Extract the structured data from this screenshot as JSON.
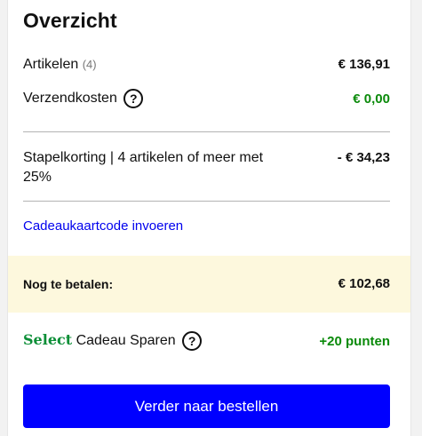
{
  "summary": {
    "title": "Overzicht",
    "articles_label": "Artikelen",
    "articles_count": "(4)",
    "articles_amount": "€ 136,91",
    "shipping_label": "Verzendkosten",
    "shipping_amount": "€ 0,00",
    "discount_label_line1": "Stapelkorting | 4 artikelen of meer met",
    "discount_label_line2": "25%",
    "discount_amount": "- € 34,23",
    "giftcard_link": "Cadeaukaartcode invoeren",
    "total_label": "Nog te betalen:",
    "total_amount": "€ 102,68",
    "select_brand": "Select",
    "select_label": "Cadeau Sparen",
    "select_points": "+20 punten",
    "help_symbol": "?",
    "cta_label": "Verder naar bestellen"
  },
  "colors": {
    "cta_background": "#0000ff",
    "positive_green": "#0a8a0a",
    "link_blue": "#0000ee",
    "total_band": "#fdf8dd"
  },
  "icons": [
    "help-icon"
  ]
}
